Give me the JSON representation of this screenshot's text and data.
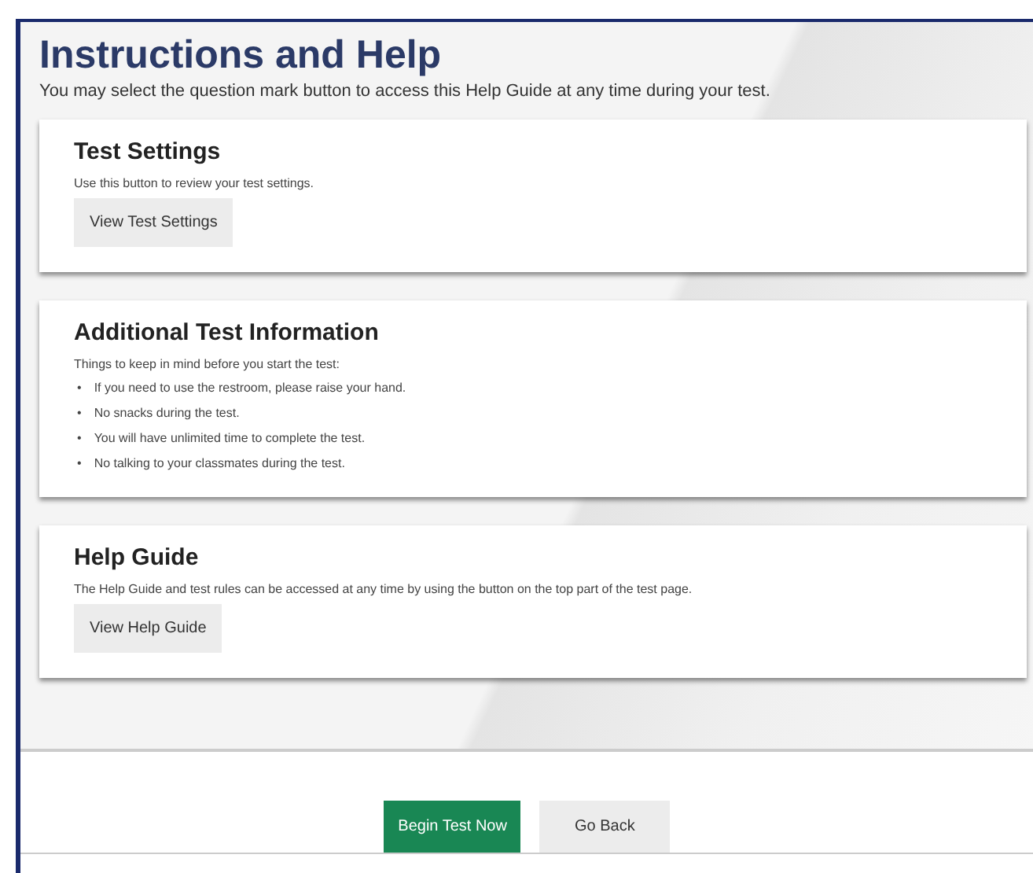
{
  "title": "Instructions and Help",
  "subtitle": "You may select the question mark button to access this Help Guide at any time during your test.",
  "sections": [
    {
      "heading": "Test Settings",
      "text": "Use this button to review your test settings.",
      "button": "View Test Settings"
    },
    {
      "heading": "Additional Test Information",
      "text": "Things to keep in mind before you start the test:",
      "items": [
        {
          "marker": "•",
          "text": "If you need to use the restroom, please raise your hand."
        },
        {
          "marker": "•",
          "text": "No snacks during the test."
        },
        {
          "marker": "•",
          "text": "You will have unlimited time to complete the test."
        },
        {
          "marker": "•",
          "text": "No talking to your classmates during the test."
        }
      ]
    },
    {
      "heading": "Help Guide",
      "text": "The Help Guide and test rules can be accessed at any time by using the button on the top part of the test page.",
      "button": "View Help Guide"
    }
  ],
  "footer_buttons": [
    {
      "label": "Begin Test Now",
      "kind": "primary"
    },
    {
      "label": "Go Back",
      "kind": "secondary"
    }
  ]
}
